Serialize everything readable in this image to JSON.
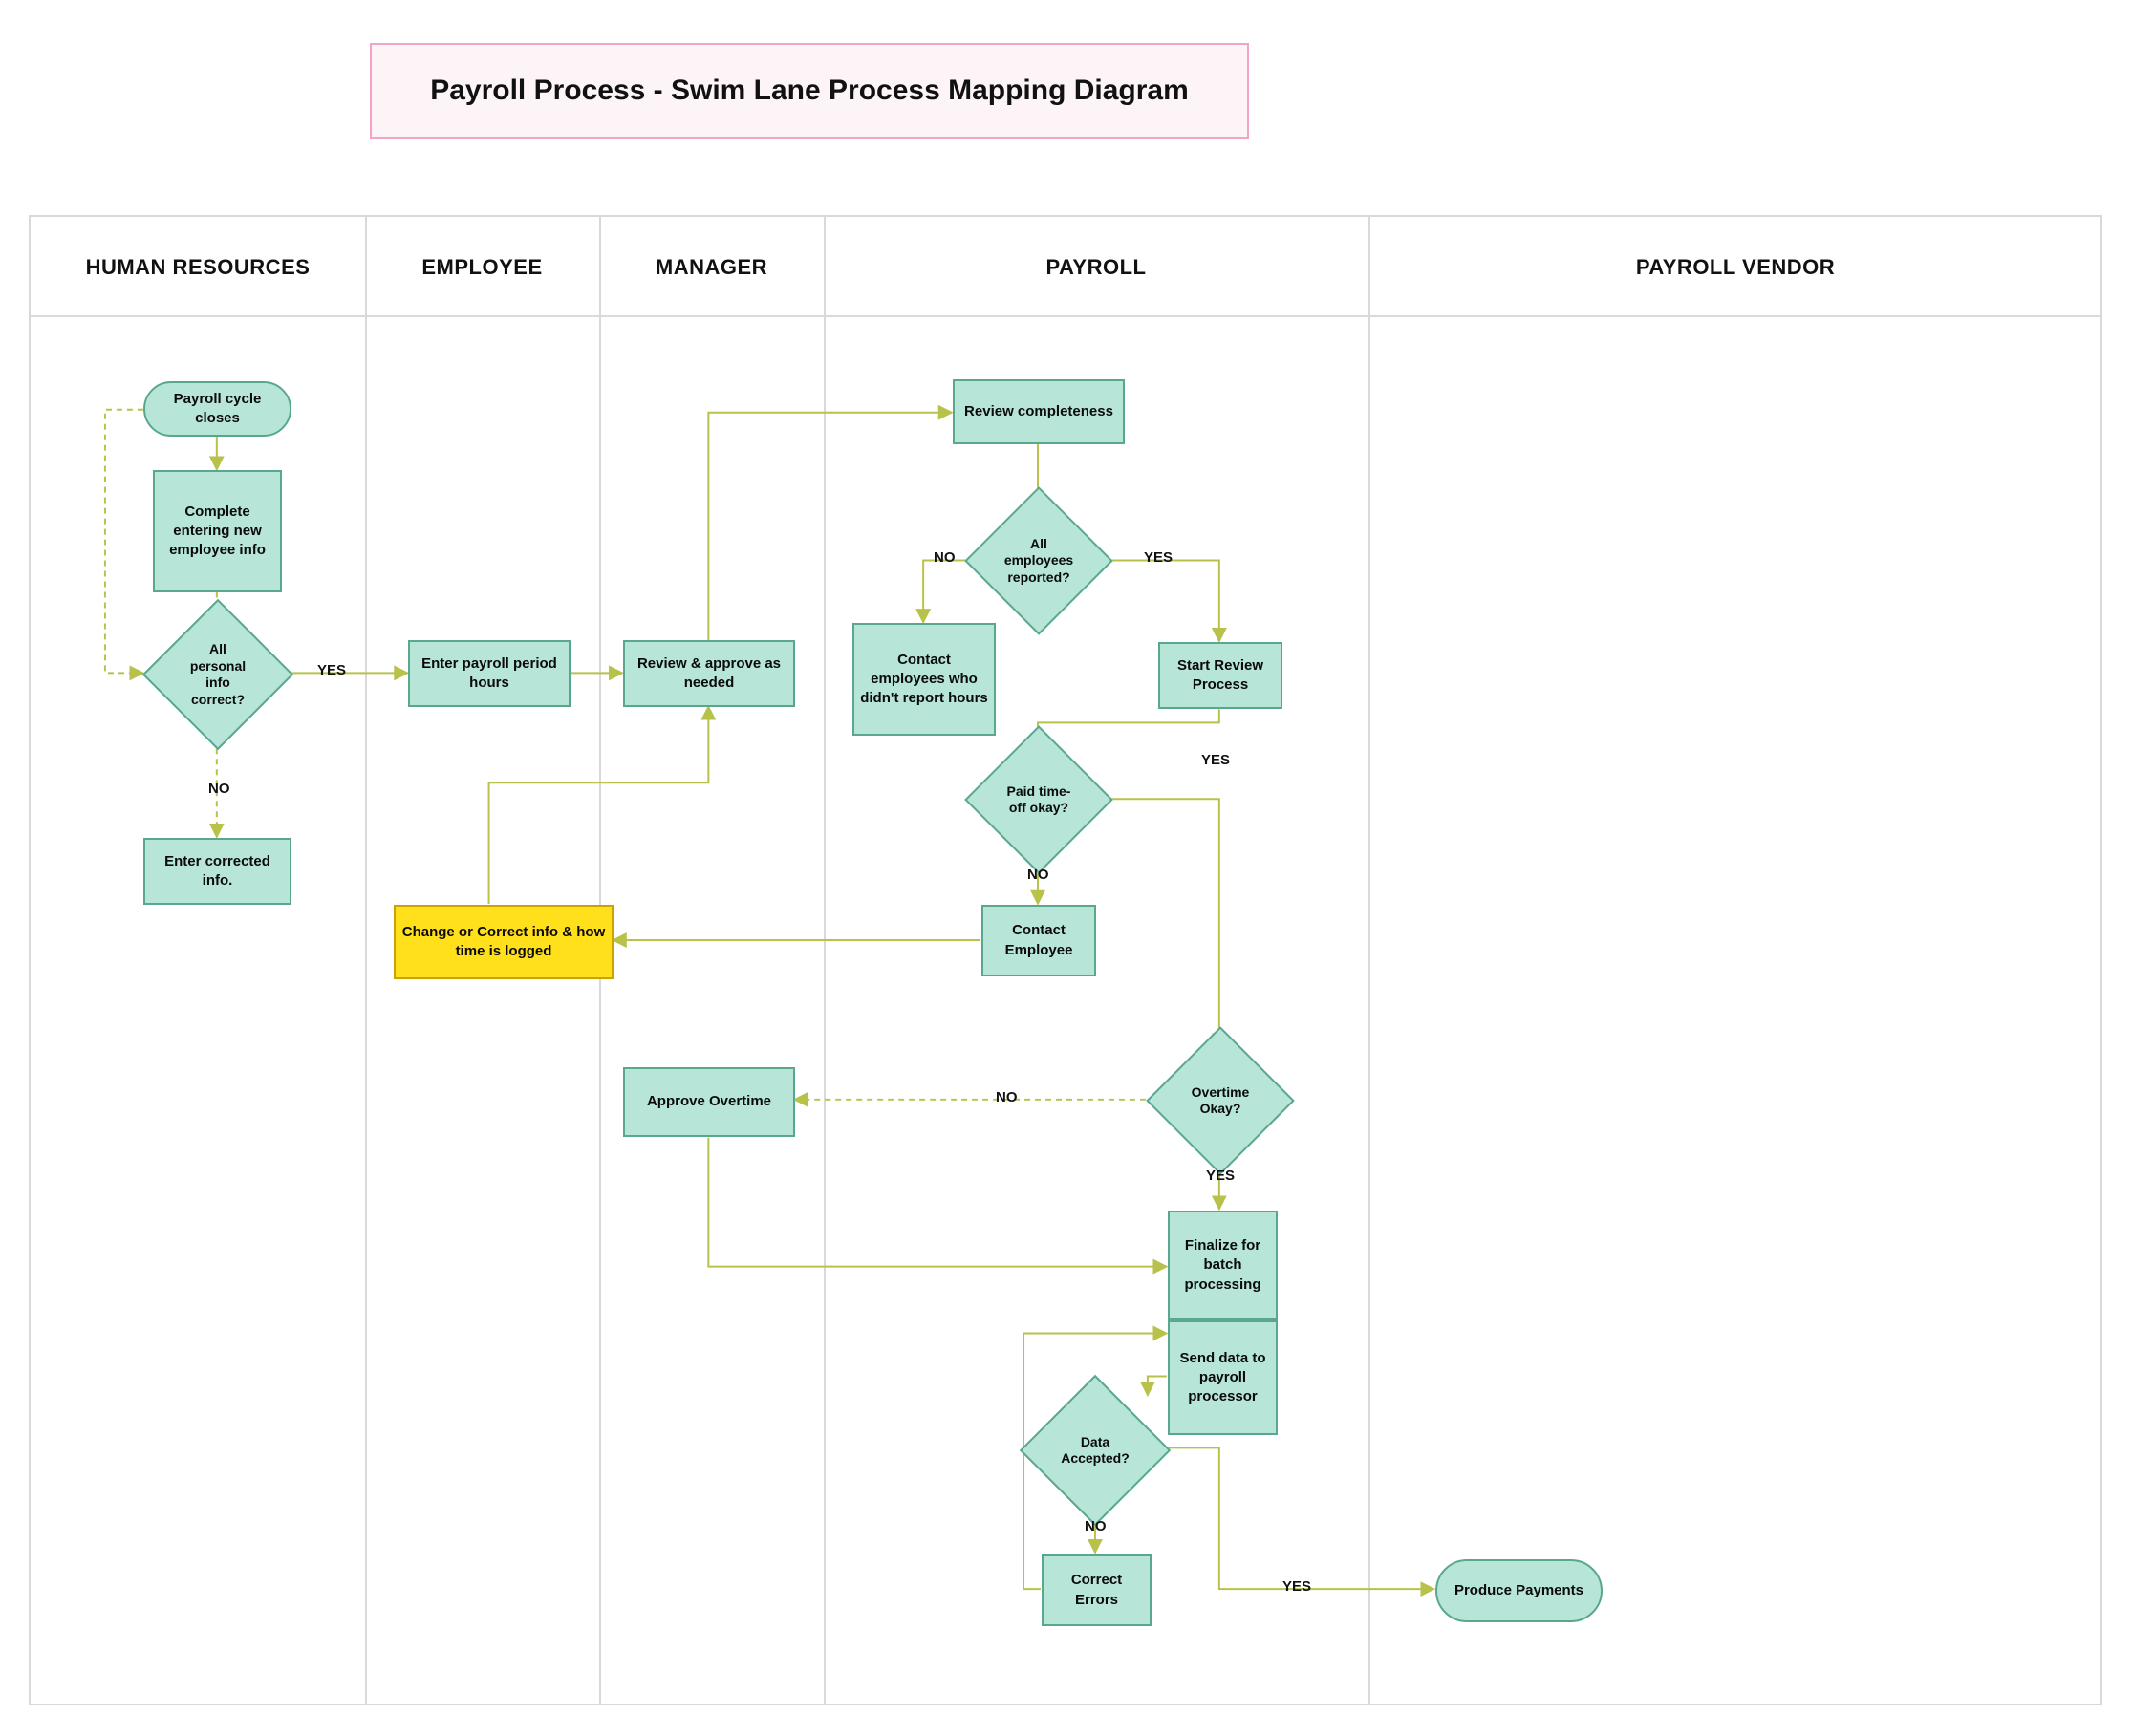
{
  "title": "Payroll Process - Swim Lane Process Mapping Diagram",
  "lanes": {
    "hr": "HUMAN RESOURCES",
    "employee": "EMPLOYEE",
    "manager": "MANAGER",
    "payroll": "PAYROLL",
    "vendor": "PAYROLL VENDOR"
  },
  "nodes": {
    "start": "Payroll cycle closes",
    "completeInfo": "Complete entering new employee info",
    "checkInfo": "All personal info correct?",
    "enterCorrected": "Enter corrected info.",
    "enterHours": "Enter payroll period hours",
    "reviewApprove": "Review & approve as needed",
    "reviewCompleteness": "Review completeness",
    "allReported": "All employees reported?",
    "contactNotReported": "Contact employees who didn't report hours",
    "startReview": "Start Review Process",
    "paidTimeOff": "Paid time-off okay?",
    "contactEmployee": "Contact Employee",
    "changeCorrect": "Change or Correct info & how time is logged",
    "overtimeOkay": "Overtime Okay?",
    "approveOvertime": "Approve Overtime",
    "finalizeBatch": "Finalize for batch processing",
    "sendData": "Send data to payroll processor",
    "dataAccepted": "Data Accepted?",
    "correctErrors": "Correct Errors",
    "producePayments": "Produce Payments"
  },
  "labels": {
    "yes": "YES",
    "no": "NO"
  },
  "style": {
    "nodeFill": "#b7e6d8",
    "nodeStroke": "#5aa78f",
    "highlightFill": "#ffe01a",
    "connectorColor": "#b8c24a",
    "laneBorder": "#d9d9d9"
  }
}
